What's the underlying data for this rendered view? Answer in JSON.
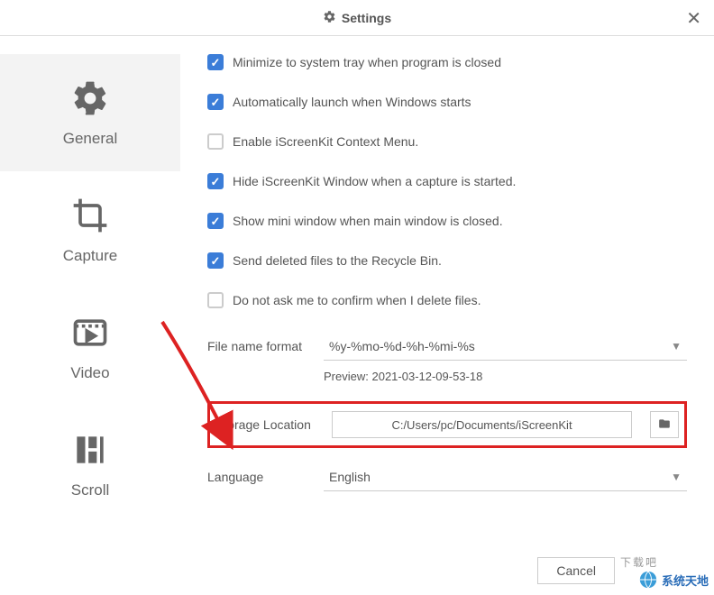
{
  "title": "Settings",
  "sidebar": {
    "items": [
      {
        "label": "General"
      },
      {
        "label": "Capture"
      },
      {
        "label": "Video"
      },
      {
        "label": "Scroll"
      }
    ]
  },
  "options": {
    "minimize": {
      "label": "Minimize to system tray when program is closed",
      "checked": true
    },
    "autostart": {
      "label": "Automatically launch when Windows starts",
      "checked": true
    },
    "contextmenu": {
      "label": "Enable iScreenKit Context Menu.",
      "checked": false
    },
    "hidewindow": {
      "label": "Hide iScreenKit Window when a capture is started.",
      "checked": true
    },
    "miniwindow": {
      "label": "Show mini window when main window is closed.",
      "checked": true
    },
    "recyclebin": {
      "label": "Send deleted files to the Recycle Bin.",
      "checked": true
    },
    "noconfirm": {
      "label": "Do not ask me to confirm when I delete files.",
      "checked": false
    }
  },
  "filename": {
    "label": "File name format",
    "value": "%y-%mo-%d-%h-%mi-%s",
    "preview_label": "Preview:",
    "preview_value": "2021-03-12-09-53-18"
  },
  "storage": {
    "label": "Storage Location",
    "value": "C:/Users/pc/Documents/iScreenKit"
  },
  "language": {
    "label": "Language",
    "value": "English"
  },
  "buttons": {
    "cancel": "Cancel"
  },
  "watermark": "系统天地"
}
